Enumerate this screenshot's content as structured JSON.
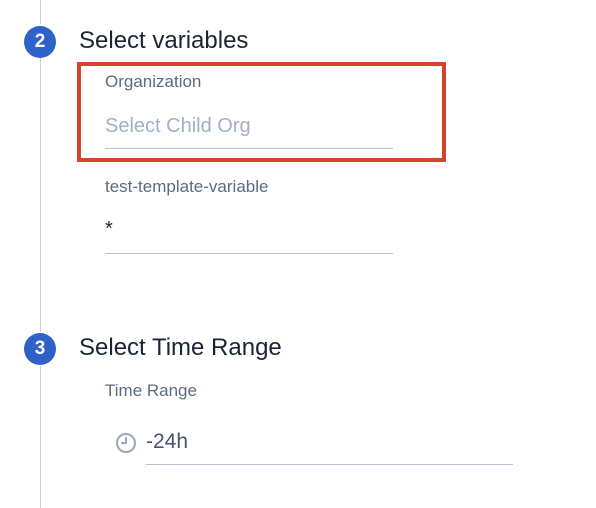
{
  "steps": [
    {
      "number": "2",
      "title": "Select variables",
      "fields": [
        {
          "label": "Organization",
          "placeholder": "Select Child Org",
          "value": ""
        },
        {
          "label": "test-template-variable",
          "value": "*"
        }
      ]
    },
    {
      "number": "3",
      "title": "Select Time Range",
      "fields": [
        {
          "label": "Time Range",
          "value": "-24h",
          "icon": "clock-icon"
        }
      ]
    }
  ],
  "colors": {
    "accent": "#2f62c8",
    "highlight": "#d6412e",
    "label": "#5b6b82",
    "placeholder": "#a3b0c2",
    "title": "#1b2433"
  }
}
